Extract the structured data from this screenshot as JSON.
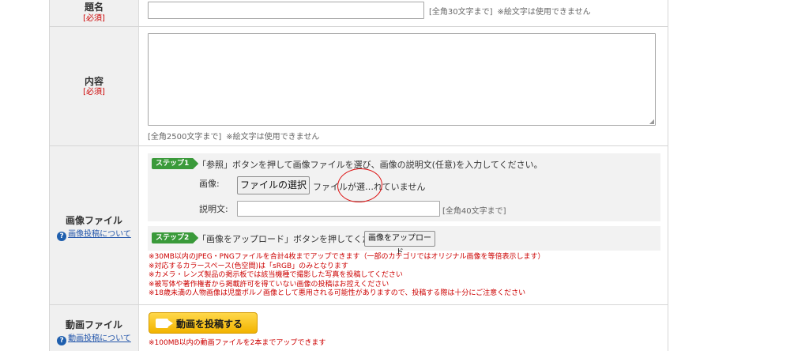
{
  "title_row": {
    "label": "題名",
    "required": "[必須]",
    "hint": "[全角30文字まで]",
    "hint_note": "※絵文字は使用できません"
  },
  "content_row": {
    "label": "内容",
    "required": "[必須]",
    "hint": "[全角2500文字まで]",
    "hint_note": "※絵文字は使用できません"
  },
  "image_row": {
    "label": "画像ファイル",
    "help_link": "画像投稿について",
    "step1": {
      "badge": "ステップ1",
      "text": "「参照」ボタンを押して画像ファイルを選び、画像の説明文(任意)を入力してください。",
      "image_label": "画像:",
      "file_button": "ファイルの選択",
      "file_status": "ファイルが選…れていません",
      "desc_label": "説明文:",
      "desc_hint": "[全角40文字まで]"
    },
    "step2": {
      "badge": "ステップ2",
      "text": "「画像をアップロード」ボタンを押してください。",
      "upload_button": "画像をアップロード"
    },
    "notes": [
      "※30MB以内のJPEG・PNGファイルを合計4枚までアップできます（一部のカテゴリではオリジナル画像を等倍表示します）",
      "※対応するカラースペース(色空間)は「sRGB」のみとなります",
      "※カメラ・レンズ製品の掲示板では該当機種で撮影した写真を投稿してください",
      "※被写体や著作権者から掲載許可を得ていない画像の投稿はお控えください",
      "※18歳未満の人物画像は児童ポルノ画像として悪用される可能性がありますので、投稿する際は十分にご注意ください"
    ]
  },
  "video_row": {
    "label": "動画ファイル",
    "help_link": "動画投稿について",
    "button": "動画を投稿する",
    "note": "※100MB以内の動画ファイルを2本までアップできます"
  },
  "colors": {
    "step_badge": "#3a9a3a",
    "required": "#cc0000",
    "link": "#2255aa",
    "video_button": "#f5c010",
    "annotation": "#dd1111"
  }
}
